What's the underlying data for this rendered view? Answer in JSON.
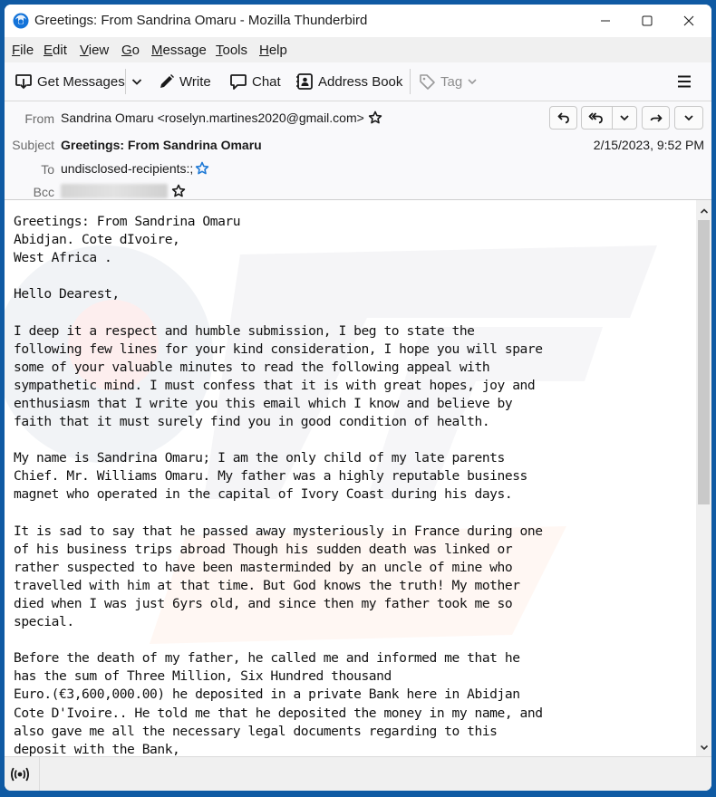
{
  "window": {
    "title": "Greetings: From Sandrina Omaru - Mozilla Thunderbird",
    "app_icon": "thunderbird-logo-icon",
    "controls": [
      "minimize-icon",
      "maximize-icon",
      "close-icon"
    ]
  },
  "menubar": {
    "items": [
      {
        "label": "File",
        "accel": "F",
        "rest": "ile"
      },
      {
        "label": "Edit",
        "accel": "E",
        "rest": "dit"
      },
      {
        "label": "View",
        "accel": "V",
        "rest": "iew"
      },
      {
        "label": "Go",
        "accel": "G",
        "rest": "o"
      },
      {
        "label": "Message",
        "accel": "M",
        "rest": "essage"
      },
      {
        "label": "Tools",
        "accel": "T",
        "rest": "ools"
      },
      {
        "label": "Help",
        "accel": "H",
        "rest": "elp"
      }
    ]
  },
  "toolbar": {
    "get_messages": "Get Messages",
    "write": "Write",
    "chat": "Chat",
    "address_book": "Address Book",
    "tag": "Tag",
    "menu_icon": "hamburger-menu-icon"
  },
  "header": {
    "from_label": "From",
    "from_value": "Sandrina Omaru <roselyn.martines2020@gmail.com>",
    "subject_label": "Subject",
    "subject_value": "Greetings: From Sandrina Omaru",
    "to_label": "To",
    "to_value": "undisclosed-recipients:;",
    "bcc_label": "Bcc",
    "bcc_value_state": "redacted/blurred",
    "date": "2/15/2023, 9:52 PM",
    "actions": [
      "reply",
      "reply-all",
      "reply-all-dropdown",
      "forward",
      "more-dropdown"
    ]
  },
  "message": {
    "body": "Greetings: From Sandrina Omaru\nAbidjan. Cote dIvoire,\nWest Africa .\n\nHello Dearest,\n\nI deep it a respect and humble submission, I beg to state the\nfollowing few lines for your kind consideration, I hope you will spare\nsome of your valuable minutes to read the following appeal with\nsympathetic mind. I must confess that it is with great hopes, joy and\nenthusiasm that I write you this email which I know and believe by\nfaith that it must surely find you in good condition of health.\n\nMy name is Sandrina Omaru; I am the only child of my late parents\nChief. Mr. Williams Omaru. My father was a highly reputable business\nmagnet who operated in the capital of Ivory Coast during his days.\n\nIt is sad to say that he passed away mysteriously in France during one\nof his business trips abroad Though his sudden death was linked or\nrather suspected to have been masterminded by an uncle of mine who\ntravelled with him at that time. But God knows the truth! My mother\ndied when I was just 6yrs old, and since then my father took me so\nspecial.\n\nBefore the death of my father, he called me and informed me that he\nhas the sum of Three Million, Six Hundred thousand\nEuro.(€3,600,000.00) he deposited in a private Bank here in Abidjan\nCote D'Ivoire.. He told me that he deposited the money in my name, and\nalso gave me all the necessary legal documents regarding to this\ndeposit with the Bank,"
  },
  "scrollbar": {
    "position_fraction": 0.0,
    "visible_fraction": 0.55
  },
  "statusbar": {
    "icon": "online-status-icon"
  },
  "colors": {
    "window_frame": "#0f5aa3",
    "star_blue": "#1f7ad6",
    "text": "#1a1a1a",
    "muted_label": "#6b6b6b"
  }
}
